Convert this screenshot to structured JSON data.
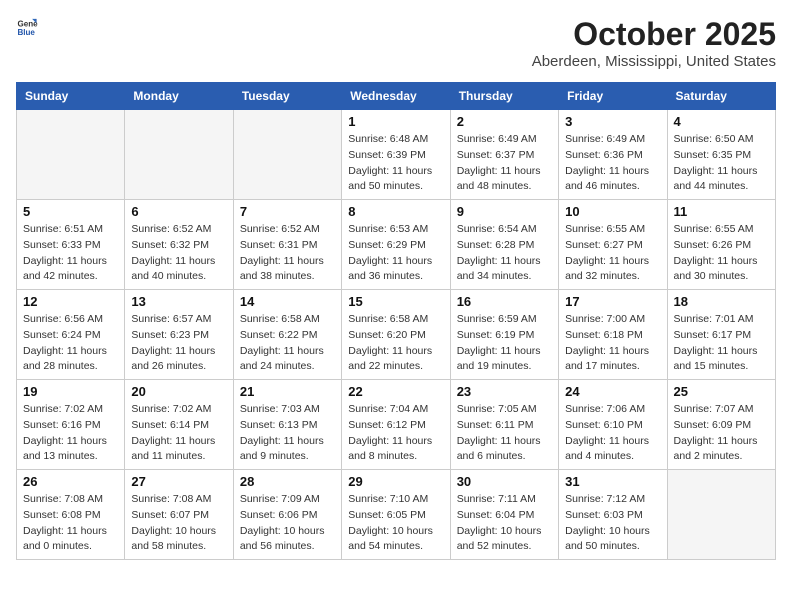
{
  "logo": {
    "general": "General",
    "blue": "Blue"
  },
  "title": "October 2025",
  "location": "Aberdeen, Mississippi, United States",
  "headers": [
    "Sunday",
    "Monday",
    "Tuesday",
    "Wednesday",
    "Thursday",
    "Friday",
    "Saturday"
  ],
  "weeks": [
    [
      {
        "day": "",
        "info": ""
      },
      {
        "day": "",
        "info": ""
      },
      {
        "day": "",
        "info": ""
      },
      {
        "day": "1",
        "info": "Sunrise: 6:48 AM\nSunset: 6:39 PM\nDaylight: 11 hours\nand 50 minutes."
      },
      {
        "day": "2",
        "info": "Sunrise: 6:49 AM\nSunset: 6:37 PM\nDaylight: 11 hours\nand 48 minutes."
      },
      {
        "day": "3",
        "info": "Sunrise: 6:49 AM\nSunset: 6:36 PM\nDaylight: 11 hours\nand 46 minutes."
      },
      {
        "day": "4",
        "info": "Sunrise: 6:50 AM\nSunset: 6:35 PM\nDaylight: 11 hours\nand 44 minutes."
      }
    ],
    [
      {
        "day": "5",
        "info": "Sunrise: 6:51 AM\nSunset: 6:33 PM\nDaylight: 11 hours\nand 42 minutes."
      },
      {
        "day": "6",
        "info": "Sunrise: 6:52 AM\nSunset: 6:32 PM\nDaylight: 11 hours\nand 40 minutes."
      },
      {
        "day": "7",
        "info": "Sunrise: 6:52 AM\nSunset: 6:31 PM\nDaylight: 11 hours\nand 38 minutes."
      },
      {
        "day": "8",
        "info": "Sunrise: 6:53 AM\nSunset: 6:29 PM\nDaylight: 11 hours\nand 36 minutes."
      },
      {
        "day": "9",
        "info": "Sunrise: 6:54 AM\nSunset: 6:28 PM\nDaylight: 11 hours\nand 34 minutes."
      },
      {
        "day": "10",
        "info": "Sunrise: 6:55 AM\nSunset: 6:27 PM\nDaylight: 11 hours\nand 32 minutes."
      },
      {
        "day": "11",
        "info": "Sunrise: 6:55 AM\nSunset: 6:26 PM\nDaylight: 11 hours\nand 30 minutes."
      }
    ],
    [
      {
        "day": "12",
        "info": "Sunrise: 6:56 AM\nSunset: 6:24 PM\nDaylight: 11 hours\nand 28 minutes."
      },
      {
        "day": "13",
        "info": "Sunrise: 6:57 AM\nSunset: 6:23 PM\nDaylight: 11 hours\nand 26 minutes."
      },
      {
        "day": "14",
        "info": "Sunrise: 6:58 AM\nSunset: 6:22 PM\nDaylight: 11 hours\nand 24 minutes."
      },
      {
        "day": "15",
        "info": "Sunrise: 6:58 AM\nSunset: 6:20 PM\nDaylight: 11 hours\nand 22 minutes."
      },
      {
        "day": "16",
        "info": "Sunrise: 6:59 AM\nSunset: 6:19 PM\nDaylight: 11 hours\nand 19 minutes."
      },
      {
        "day": "17",
        "info": "Sunrise: 7:00 AM\nSunset: 6:18 PM\nDaylight: 11 hours\nand 17 minutes."
      },
      {
        "day": "18",
        "info": "Sunrise: 7:01 AM\nSunset: 6:17 PM\nDaylight: 11 hours\nand 15 minutes."
      }
    ],
    [
      {
        "day": "19",
        "info": "Sunrise: 7:02 AM\nSunset: 6:16 PM\nDaylight: 11 hours\nand 13 minutes."
      },
      {
        "day": "20",
        "info": "Sunrise: 7:02 AM\nSunset: 6:14 PM\nDaylight: 11 hours\nand 11 minutes."
      },
      {
        "day": "21",
        "info": "Sunrise: 7:03 AM\nSunset: 6:13 PM\nDaylight: 11 hours\nand 9 minutes."
      },
      {
        "day": "22",
        "info": "Sunrise: 7:04 AM\nSunset: 6:12 PM\nDaylight: 11 hours\nand 8 minutes."
      },
      {
        "day": "23",
        "info": "Sunrise: 7:05 AM\nSunset: 6:11 PM\nDaylight: 11 hours\nand 6 minutes."
      },
      {
        "day": "24",
        "info": "Sunrise: 7:06 AM\nSunset: 6:10 PM\nDaylight: 11 hours\nand 4 minutes."
      },
      {
        "day": "25",
        "info": "Sunrise: 7:07 AM\nSunset: 6:09 PM\nDaylight: 11 hours\nand 2 minutes."
      }
    ],
    [
      {
        "day": "26",
        "info": "Sunrise: 7:08 AM\nSunset: 6:08 PM\nDaylight: 11 hours\nand 0 minutes."
      },
      {
        "day": "27",
        "info": "Sunrise: 7:08 AM\nSunset: 6:07 PM\nDaylight: 10 hours\nand 58 minutes."
      },
      {
        "day": "28",
        "info": "Sunrise: 7:09 AM\nSunset: 6:06 PM\nDaylight: 10 hours\nand 56 minutes."
      },
      {
        "day": "29",
        "info": "Sunrise: 7:10 AM\nSunset: 6:05 PM\nDaylight: 10 hours\nand 54 minutes."
      },
      {
        "day": "30",
        "info": "Sunrise: 7:11 AM\nSunset: 6:04 PM\nDaylight: 10 hours\nand 52 minutes."
      },
      {
        "day": "31",
        "info": "Sunrise: 7:12 AM\nSunset: 6:03 PM\nDaylight: 10 hours\nand 50 minutes."
      },
      {
        "day": "",
        "info": ""
      }
    ]
  ]
}
